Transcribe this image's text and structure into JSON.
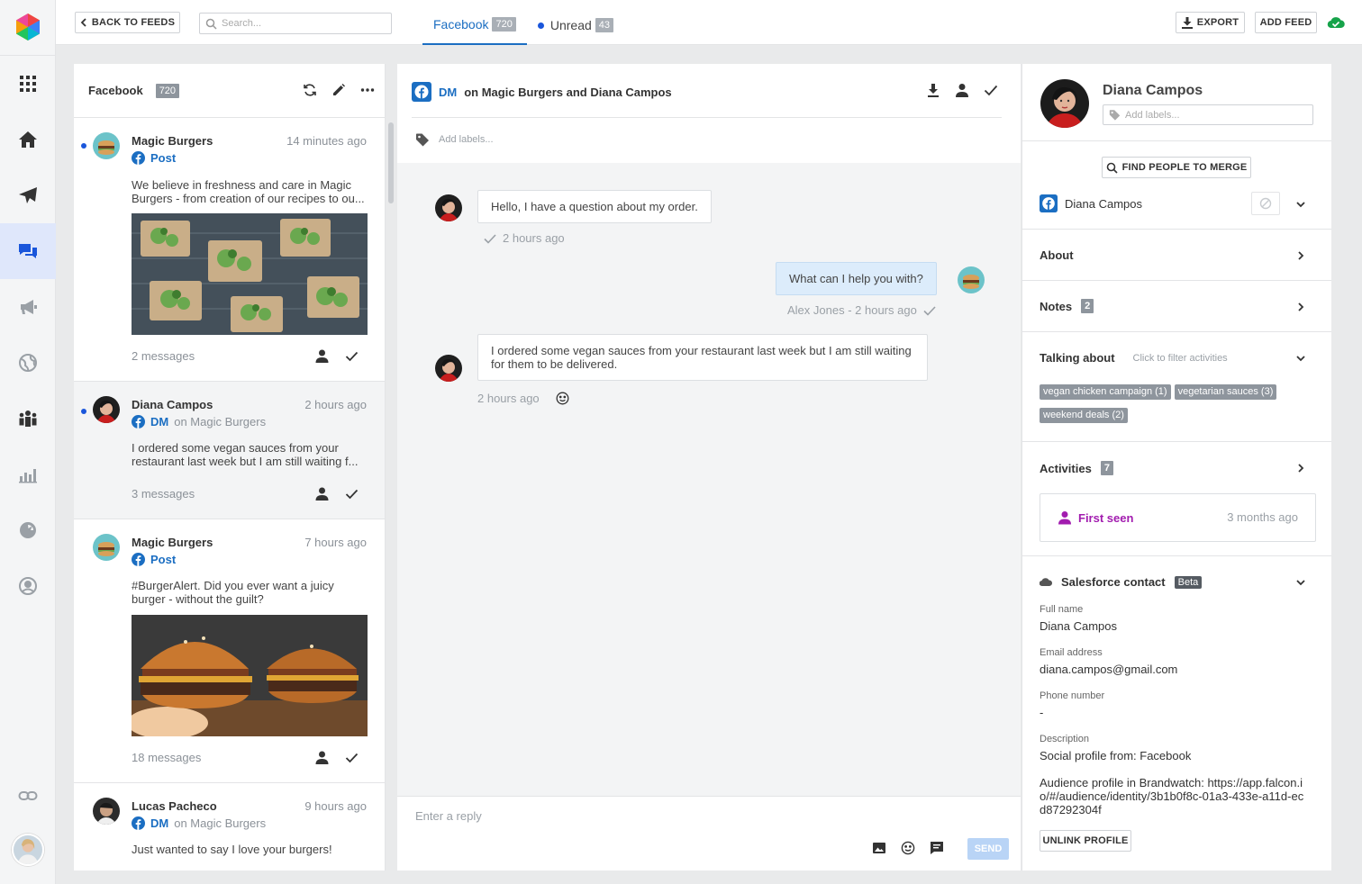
{
  "colors": {
    "accent": "#1b6ec2",
    "unread_dot": "#1a56db",
    "active_nav": "#dfe7fb",
    "purple": "#a21caf",
    "green": "#16a34a"
  },
  "nav": {
    "items": [
      "grid-icon",
      "home-icon",
      "send-icon",
      "chat-icon",
      "megaphone-icon",
      "globe-icon",
      "people-icon",
      "bar-chart-icon",
      "gauge-icon",
      "face-icon"
    ],
    "active": "chat-icon",
    "link": "link-icon"
  },
  "topbar": {
    "back_label": "BACK TO FEEDS",
    "search_placeholder": "Search...",
    "tabs": [
      {
        "label": "Facebook",
        "count": "720"
      },
      {
        "label": "Unread",
        "count": "43"
      }
    ],
    "export_label": "EXPORT",
    "add_feed_label": "ADD FEED"
  },
  "feed": {
    "title": "Facebook",
    "count": "720",
    "items": [
      {
        "name": "Magic Burgers",
        "time": "14 minutes ago",
        "kind": "Post",
        "on": "",
        "text": "We believe in freshness and care in Magic Burgers - from creation of our recipes to ou...",
        "messages": "2 messages",
        "unread": true,
        "image": "salad"
      },
      {
        "name": "Diana Campos",
        "time": "2 hours ago",
        "kind": "DM",
        "on": "on Magic Burgers",
        "text": "I ordered some vegan sauces from your restaurant last week but I am still waiting f...",
        "messages": "3 messages",
        "unread": true,
        "image": ""
      },
      {
        "name": "Magic Burgers",
        "time": "7 hours ago",
        "kind": "Post",
        "on": "",
        "text": "#BurgerAlert. Did you ever want a juicy burger - without the guilt?",
        "messages": "18 messages",
        "unread": false,
        "image": "burger"
      },
      {
        "name": "Lucas Pacheco",
        "time": "9 hours ago",
        "kind": "DM",
        "on": "on Magic Burgers",
        "text": "Just wanted to say I love your burgers!",
        "messages": "",
        "unread": false,
        "image": ""
      }
    ]
  },
  "conversation": {
    "kind": "DM",
    "title": "on Magic Burgers and Diana Campos",
    "labels_placeholder": "Add labels...",
    "messages": [
      {
        "text": "Hello, I have a question about my order.",
        "meta": "2 hours ago",
        "direction": "in"
      },
      {
        "text": "What can I help you with?",
        "meta": "Alex Jones - 2 hours ago",
        "direction": "out"
      },
      {
        "text": "I ordered some vegan sauces from your restaurant last week but I am still waiting for them to be delivered.",
        "meta": "2 hours ago",
        "direction": "in"
      }
    ],
    "reply_placeholder": "Enter a reply",
    "send_label": "SEND"
  },
  "profile": {
    "name": "Diana Campos",
    "labels_placeholder": "Add labels...",
    "merge_label": "FIND PEOPLE TO MERGE",
    "account_name": "Diana Campos",
    "about_label": "About",
    "notes_label": "Notes",
    "notes_count": "2",
    "talking_label": "Talking about",
    "talking_hint": "Click to filter activities",
    "topics": [
      "vegan chicken campaign (1)",
      "vegetarian sauces (3)",
      "weekend deals (2)"
    ],
    "activities_label": "Activities",
    "activities_count": "7",
    "first_seen_label": "First seen",
    "first_seen_time": "3 months ago",
    "salesforce_label": "Salesforce contact",
    "beta_label": "Beta",
    "fields": [
      {
        "label": "Full name",
        "value": "Diana Campos"
      },
      {
        "label": "Email address",
        "value": "diana.campos@gmail.com"
      },
      {
        "label": "Phone number",
        "value": "-"
      },
      {
        "label": "Description",
        "value": "Social profile from: Facebook"
      }
    ],
    "audience_text": "Audience profile in Brandwatch: https://app.falcon.io/#/audience/identity/3b1b0f8c-01a3-433e-a11d-ecd87292304f",
    "unlink_label": "UNLINK PROFILE"
  }
}
